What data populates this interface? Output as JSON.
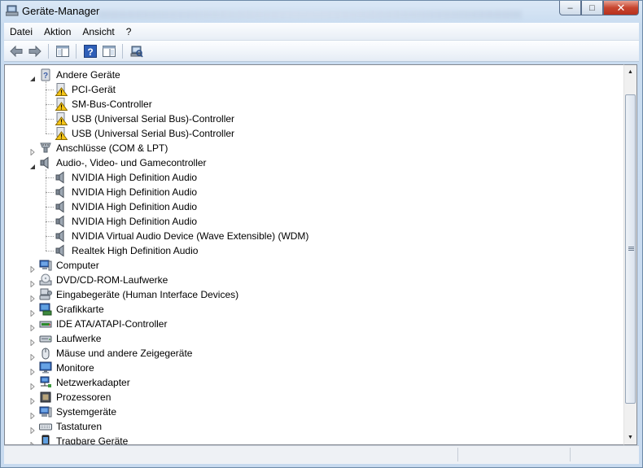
{
  "window": {
    "title": "Geräte-Manager",
    "caption_buttons": {
      "minimize": "–",
      "maximize": "□",
      "close": "✕"
    }
  },
  "menu": [
    "Datei",
    "Aktion",
    "Ansicht",
    "?"
  ],
  "toolbar": [
    {
      "name": "back-icon"
    },
    {
      "name": "forward-icon"
    },
    {
      "name": "show-hide-console-tree-icon"
    },
    {
      "name": "help-icon"
    },
    {
      "name": "properties-view-icon"
    },
    {
      "name": "scan-hardware-icon"
    }
  ],
  "tree": [
    {
      "level": 0,
      "label": "Andere Geräte",
      "expanded": true,
      "icon": "unknown-device-icon"
    },
    {
      "level": 1,
      "label": "PCI-Gerät",
      "icon": "warning-device-icon"
    },
    {
      "level": 1,
      "label": "SM-Bus-Controller",
      "icon": "warning-device-icon"
    },
    {
      "level": 1,
      "label": "USB (Universal Serial Bus)-Controller",
      "icon": "warning-device-icon"
    },
    {
      "level": 1,
      "label": "USB (Universal Serial Bus)-Controller",
      "icon": "warning-device-icon"
    },
    {
      "level": 0,
      "label": "Anschlüsse (COM & LPT)",
      "expanded": false,
      "icon": "port-icon"
    },
    {
      "level": 0,
      "label": "Audio-, Video- und Gamecontroller",
      "expanded": true,
      "icon": "speaker-icon"
    },
    {
      "level": 1,
      "label": "NVIDIA High Definition Audio",
      "icon": "speaker-icon"
    },
    {
      "level": 1,
      "label": "NVIDIA High Definition Audio",
      "icon": "speaker-icon"
    },
    {
      "level": 1,
      "label": "NVIDIA High Definition Audio",
      "icon": "speaker-icon"
    },
    {
      "level": 1,
      "label": "NVIDIA High Definition Audio",
      "icon": "speaker-icon"
    },
    {
      "level": 1,
      "label": "NVIDIA Virtual Audio Device (Wave Extensible) (WDM)",
      "icon": "speaker-icon"
    },
    {
      "level": 1,
      "label": "Realtek High Definition Audio",
      "icon": "speaker-icon"
    },
    {
      "level": 0,
      "label": "Computer",
      "expanded": false,
      "icon": "computer-icon"
    },
    {
      "level": 0,
      "label": "DVD/CD-ROM-Laufwerke",
      "expanded": false,
      "icon": "dvd-drive-icon"
    },
    {
      "level": 0,
      "label": "Eingabegeräte (Human Interface Devices)",
      "expanded": false,
      "icon": "hid-icon"
    },
    {
      "level": 0,
      "label": "Grafikkarte",
      "expanded": false,
      "icon": "display-adapter-icon"
    },
    {
      "level": 0,
      "label": "IDE ATA/ATAPI-Controller",
      "expanded": false,
      "icon": "ide-controller-icon"
    },
    {
      "level": 0,
      "label": "Laufwerke",
      "expanded": false,
      "icon": "disk-drive-icon"
    },
    {
      "level": 0,
      "label": "Mäuse und andere Zeigegeräte",
      "expanded": false,
      "icon": "mouse-icon"
    },
    {
      "level": 0,
      "label": "Monitore",
      "expanded": false,
      "icon": "monitor-icon"
    },
    {
      "level": 0,
      "label": "Netzwerkadapter",
      "expanded": false,
      "icon": "network-adapter-icon"
    },
    {
      "level": 0,
      "label": "Prozessoren",
      "expanded": false,
      "icon": "processor-icon"
    },
    {
      "level": 0,
      "label": "Systemgeräte",
      "expanded": false,
      "icon": "system-devices-icon"
    },
    {
      "level": 0,
      "label": "Tastaturen",
      "expanded": false,
      "icon": "keyboard-icon"
    },
    {
      "level": 0,
      "label": "Tragbare Geräte",
      "expanded": false,
      "icon": "portable-device-icon"
    }
  ]
}
